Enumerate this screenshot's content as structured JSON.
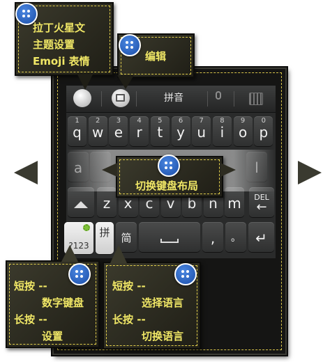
{
  "callouts": {
    "theme": {
      "line1": "拉丁火星文",
      "line2": "主题设置",
      "line3": "Emoji 表情"
    },
    "edit": {
      "label": "编辑"
    },
    "switch_layout": {
      "label": "切换键盘布局"
    },
    "num_key": {
      "line1": "短按 --",
      "line2": "数字键盘",
      "line3": "长按 --",
      "line4": "设置"
    },
    "lang_key": {
      "line1": "短按 --",
      "line2": "选择语言",
      "line3": "长按 --",
      "line4": "切换语言"
    }
  },
  "toolbar": {
    "input_mode": "拼音"
  },
  "keys": {
    "row1": [
      {
        "num": "1",
        "letter": "q"
      },
      {
        "num": "2",
        "letter": "w"
      },
      {
        "num": "3",
        "letter": "e"
      },
      {
        "num": "4",
        "letter": "r"
      },
      {
        "num": "5",
        "letter": "t"
      },
      {
        "num": "6",
        "letter": "y"
      },
      {
        "num": "7",
        "letter": "u"
      },
      {
        "num": "8",
        "letter": "i"
      },
      {
        "num": "9",
        "letter": "o"
      },
      {
        "num": "0",
        "letter": "p"
      }
    ],
    "row2": [
      "a",
      "l"
    ],
    "row3": [
      "z",
      "x",
      "c",
      "v",
      "b",
      "n",
      "m"
    ],
    "del": "DEL",
    "numpad": "?123",
    "pinyin": "拼",
    "simplified": "简",
    "comma": ",",
    "period": "。"
  },
  "colors": {
    "callout_text": "#f0e766",
    "dash": "#e3d04d",
    "accent_blue": "#2a62c4"
  }
}
